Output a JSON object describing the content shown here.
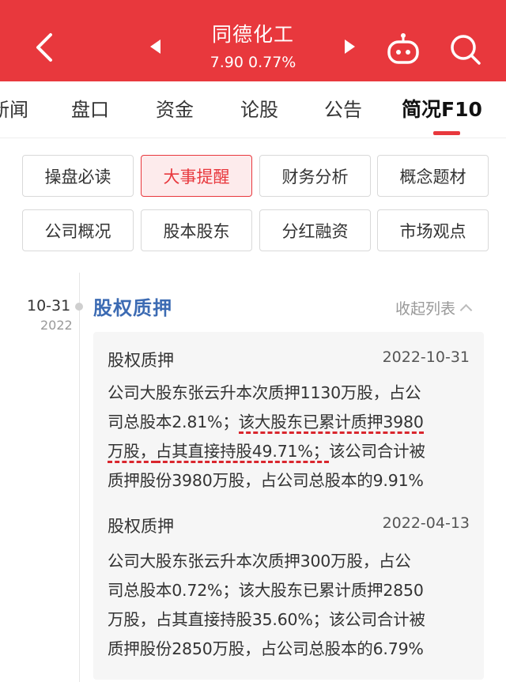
{
  "header": {
    "stock_name": "同德化工",
    "price": "7.90",
    "change_pct": "0.77%",
    "accent_color": "#e8383d",
    "icons": [
      "back-arrow-icon",
      "prev-triangle-icon",
      "next-triangle-icon",
      "robot-assistant-icon",
      "search-icon"
    ]
  },
  "tabs": [
    {
      "label": "新闻"
    },
    {
      "label": "盘口"
    },
    {
      "label": "资金"
    },
    {
      "label": "论股"
    },
    {
      "label": "公告"
    },
    {
      "label": "简况F10",
      "active": true
    }
  ],
  "sub_buttons": [
    {
      "label": "操盘必读"
    },
    {
      "label": "大事提醒",
      "active": true
    },
    {
      "label": "财务分析"
    },
    {
      "label": "概念题材"
    },
    {
      "label": "公司概况"
    },
    {
      "label": "股本股东"
    },
    {
      "label": "分红融资"
    },
    {
      "label": "市场观点"
    }
  ],
  "timeline": {
    "date": "10-31",
    "year": "2022",
    "section_title": "股权质押",
    "collapse_label": "收起列表"
  },
  "entries": [
    {
      "title": "股权质押",
      "date": "2022-10-31",
      "lines": [
        "公司大股东张云升本次质押1130万股，占公",
        "司总股本2.81%；",
        "该大股东已累计质押3980",
        "万股，",
        "占其直接持股49.71%；",
        "该公司合计被",
        "质押股份3980万股，占公司总股本的9.91%"
      ]
    },
    {
      "title": "股权质押",
      "date": "2022-04-13",
      "lines": [
        "公司大股东张云升本次质押300万股，占公",
        "司总股本0.72%；该大股东已累计质押2850",
        "万股，占其直接持股35.60%；该公司合计被",
        "质押股份2850万股，占公司总股本的6.79%"
      ]
    }
  ]
}
